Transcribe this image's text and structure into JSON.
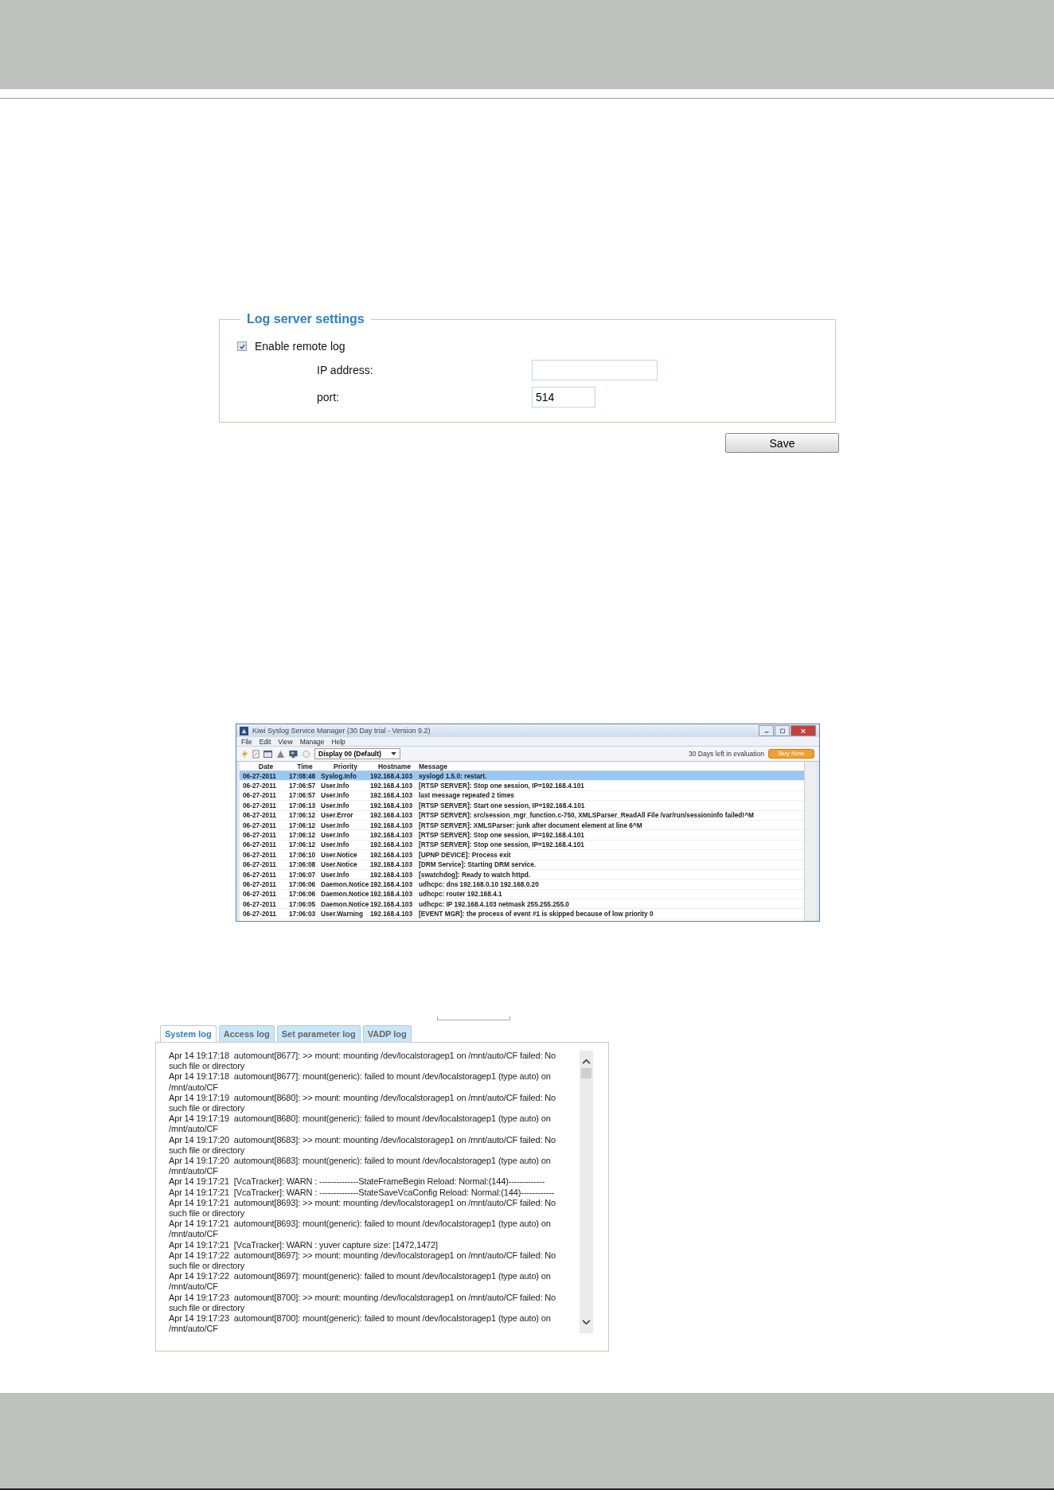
{
  "log_server_settings": {
    "title": "Log server settings",
    "enable_remote_log": {
      "label": "Enable remote log",
      "checked": true
    },
    "ip_address": {
      "label": "IP address:"
    },
    "port": {
      "label": "port:",
      "value": "514"
    },
    "save_button": "Save"
  },
  "syslog_window": {
    "title": "Kiwi Syslog Service Manager (30 Day trial - Version 9.2)",
    "menu": [
      "File",
      "Edit",
      "View",
      "Manage",
      "Help"
    ],
    "display_select": "Display 00 (Default)",
    "evaluation_notice": "30 Days left in evaluation",
    "buy_button": "Buy Now",
    "columns": [
      "Date",
      "Time",
      "Priority",
      "Hostname",
      "Message"
    ],
    "rows": [
      {
        "date": "06-27-2011",
        "time": "17:08:48",
        "priority": "Syslog.Info",
        "hostname": "192.168.4.103",
        "message": "syslogd 1.5.0: restart.",
        "selected": true
      },
      {
        "date": "06-27-2011",
        "time": "17:06:57",
        "priority": "User.Info",
        "hostname": "192.168.4.103",
        "message": "[RTSP SERVER]: Stop one session, IP=192.168.4.101",
        "selected": false
      },
      {
        "date": "06-27-2011",
        "time": "17:06:57",
        "priority": "User.Info",
        "hostname": "192.168.4.103",
        "message": "last message repeated 2 times",
        "selected": false
      },
      {
        "date": "06-27-2011",
        "time": "17:06:13",
        "priority": "User.Info",
        "hostname": "192.168.4.103",
        "message": "[RTSP SERVER]: Start one session, IP=192.168.4.101",
        "selected": false
      },
      {
        "date": "06-27-2011",
        "time": "17:06:12",
        "priority": "User.Error",
        "hostname": "192.168.4.103",
        "message": "[RTSP SERVER]: src/session_mgr_function.c-750, XMLSParser_ReadAll File /var/run/sessioninfo failed!^M",
        "selected": false
      },
      {
        "date": "06-27-2011",
        "time": "17:06:12",
        "priority": "User.Info",
        "hostname": "192.168.4.103",
        "message": "[RTSP SERVER]: XMLSParser: junk after document element at line 6^M",
        "selected": false
      },
      {
        "date": "06-27-2011",
        "time": "17:06:12",
        "priority": "User.Info",
        "hostname": "192.168.4.103",
        "message": "[RTSP SERVER]: Stop one session, IP=192.168.4.101",
        "selected": false
      },
      {
        "date": "06-27-2011",
        "time": "17:06:12",
        "priority": "User.Info",
        "hostname": "192.168.4.103",
        "message": "[RTSP SERVER]: Stop one session, IP=192.168.4.101",
        "selected": false
      },
      {
        "date": "06-27-2011",
        "time": "17:06:10",
        "priority": "User.Notice",
        "hostname": "192.168.4.103",
        "message": "[UPNP DEVICE]: Process exit",
        "selected": false
      },
      {
        "date": "06-27-2011",
        "time": "17:06:08",
        "priority": "User.Notice",
        "hostname": "192.168.4.103",
        "message": "[DRM Service]: Starting DRM service.",
        "selected": false
      },
      {
        "date": "06-27-2011",
        "time": "17:06:07",
        "priority": "User.Info",
        "hostname": "192.168.4.103",
        "message": "[swatchdog]: Ready to watch httpd.",
        "selected": false
      },
      {
        "date": "06-27-2011",
        "time": "17:06:06",
        "priority": "Daemon.Notice",
        "hostname": "192.168.4.103",
        "message": "udhcpc: dns 192.168.0.10 192.168.0.20",
        "selected": false
      },
      {
        "date": "06-27-2011",
        "time": "17:06:06",
        "priority": "Daemon.Notice",
        "hostname": "192.168.4.103",
        "message": "udhcpc: router 192.168.4.1",
        "selected": false
      },
      {
        "date": "06-27-2011",
        "time": "17:06:05",
        "priority": "Daemon.Notice",
        "hostname": "192.168.4.103",
        "message": "udhcpc: IP 192.168.4.103 netmask 255.255.255.0",
        "selected": false
      },
      {
        "date": "06-27-2011",
        "time": "17:06:03",
        "priority": "User.Warning",
        "hostname": "192.168.4.103",
        "message": "[EVENT MGR]: the process of event #1 is skipped because of low priority 0",
        "selected": false
      }
    ]
  },
  "log_viewer": {
    "tabs": [
      {
        "label": "System log",
        "selected": true
      },
      {
        "label": "Access log",
        "selected": false
      },
      {
        "label": "Set parameter log",
        "selected": false
      },
      {
        "label": "VADP log",
        "selected": false
      }
    ],
    "entries": [
      "Apr 14 19:17:18  automount[8677]: >> mount: mounting /dev/localstoragep1 on /mnt/auto/CF failed: No such file or directory",
      "Apr 14 19:17:18  automount[8677]: mount(generic): failed to mount /dev/localstoragep1 (type auto) on /mnt/auto/CF",
      "Apr 14 19:17:19  automount[8680]: >> mount: mounting /dev/localstoragep1 on /mnt/auto/CF failed: No such file or directory",
      "Apr 14 19:17:19  automount[8680]: mount(generic): failed to mount /dev/localstoragep1 (type auto) on /mnt/auto/CF",
      "Apr 14 19:17:20  automount[8683]: >> mount: mounting /dev/localstoragep1 on /mnt/auto/CF failed: No such file or directory",
      "Apr 14 19:17:20  automount[8683]: mount(generic): failed to mount /dev/localstoragep1 (type auto) on /mnt/auto/CF",
      "Apr 14 19:17:21  [VcaTracker]: WARN : --------------StateFrameBegin Reload: Normal:(144)-------------",
      "Apr 14 19:17:21  [VcaTracker]: WARN : --------------StateSaveVcaConfig Reload: Normal:(144)------------",
      "Apr 14 19:17:21  automount[8693]: >> mount: mounting /dev/localstoragep1 on /mnt/auto/CF failed: No such file or directory",
      "Apr 14 19:17:21  automount[8693]: mount(generic): failed to mount /dev/localstoragep1 (type auto) on /mnt/auto/CF",
      "Apr 14 19:17:21  [VcaTracker]: WARN : yuver capture size: [1472,1472]",
      "Apr 14 19:17:22  automount[8697]: >> mount: mounting /dev/localstoragep1 on /mnt/auto/CF failed: No such file or directory",
      "Apr 14 19:17:22  automount[8697]: mount(generic): failed to mount /dev/localstoragep1 (type auto) on /mnt/auto/CF",
      "Apr 14 19:17:23  automount[8700]: >> mount: mounting /dev/localstoragep1 on /mnt/auto/CF failed: No such file or directory",
      "Apr 14 19:17:23  automount[8700]: mount(generic): failed to mount /dev/localstoragep1 (type auto) on /mnt/auto/CF"
    ]
  }
}
